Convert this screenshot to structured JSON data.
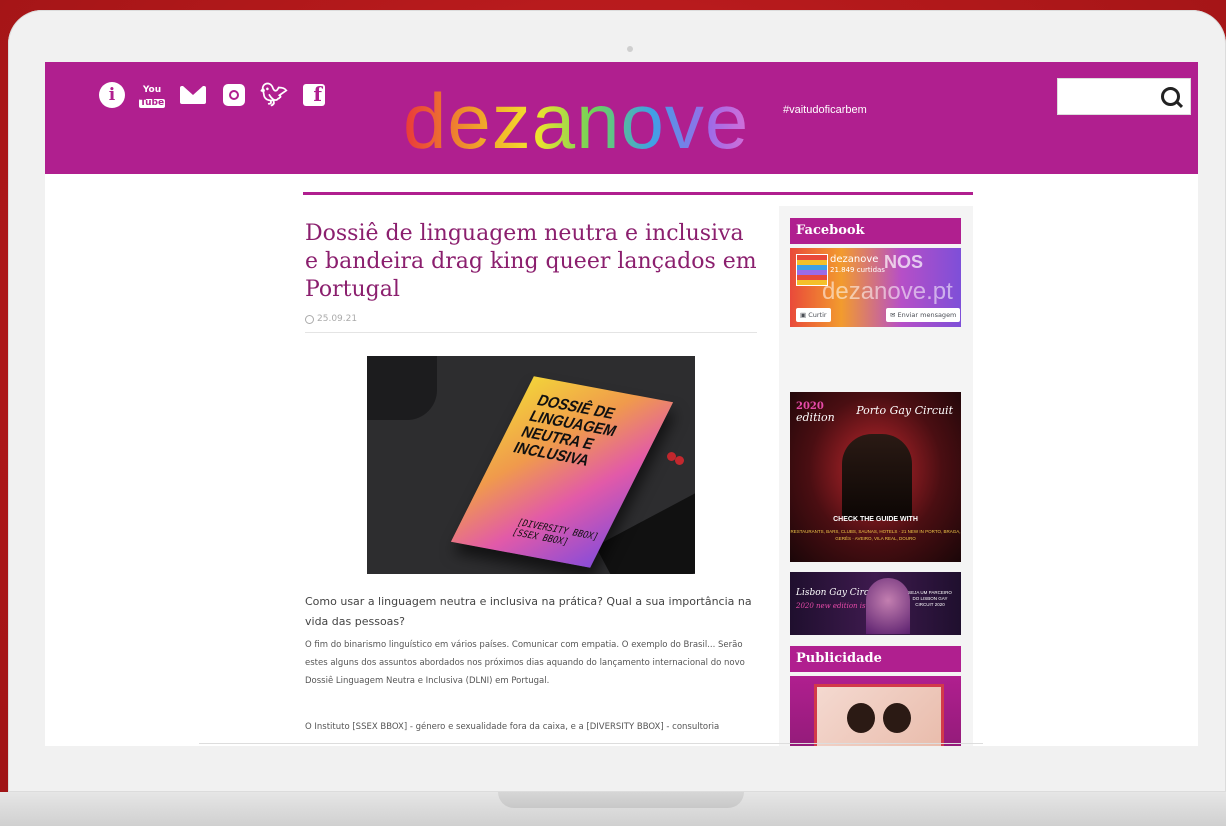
{
  "header": {
    "logo_text": "dezanove",
    "hashtag": "#vaitudoficarbem",
    "social_icons": [
      "info-icon",
      "youtube-icon",
      "mail-icon",
      "instagram-icon",
      "twitter-icon",
      "facebook-icon"
    ],
    "youtube_top": "You",
    "youtube_bottom": "Tube",
    "search_placeholder": ""
  },
  "colors": {
    "brand": "#b01f8f",
    "title": "#8b1f6e",
    "background": "#b3191b"
  },
  "article": {
    "title": "Dossiê de linguagem neutra e inclusiva e bandeira drag king queer lançados em Portugal",
    "date": "25.09.21",
    "image": {
      "book_title": "DOSSIÊ DE LINGUAGEM NEUTRA E INCLUSIVA",
      "book_logos": "[DIVERSITY BBOX] [SSEX BBOX]"
    },
    "lead": "Como usar a linguagem neutra e inclusiva na prática? Qual a sua importância na vida das pessoas?",
    "paragraph1": "O fim do binarismo linguístico em vários países. Comunicar com empatia. O exemplo do Brasil... Serão estes alguns dos assuntos abordados nos próximos dias aquando do lançamento internacional do novo Dossiê Linguagem Neutra e Inclusiva (DLNI) em Portugal.",
    "paragraph2": "O Instituto [SSEX BBOX] - género e sexualidade fora da caixa, e a [DIVERSITY BBOX] - consultoria"
  },
  "sidebar": {
    "facebook_title": "Facebook",
    "fb_page_name": "dezanove",
    "fb_likes": "21.849 curtidas",
    "fb_cover_text": "dezanove.pt",
    "fb_cover_nos": "NOS",
    "fb_like_label": "Curtir",
    "fb_message_label": "Enviar mensagem",
    "ad1": {
      "year": "2020",
      "edition": "edition",
      "brand": "Porto Gay Circuit",
      "cta": "CHECK THE GUIDE WITH",
      "sub": "RESTAURANTS, BARS, CLUBS, SAUNAS, HOTELS · 21 NEW IN PORTO, BRAGA, GERÊS · AVEIRO, VILA REAL, DOURO"
    },
    "ad2": {
      "brand": "Lisbon Gay Circuit",
      "edition": "2020 new edition is coming",
      "text": "SEJA UM PARCEIRO DO LISBON GAY CIRCUIT 2020"
    },
    "publicidade_title": "Publicidade"
  }
}
